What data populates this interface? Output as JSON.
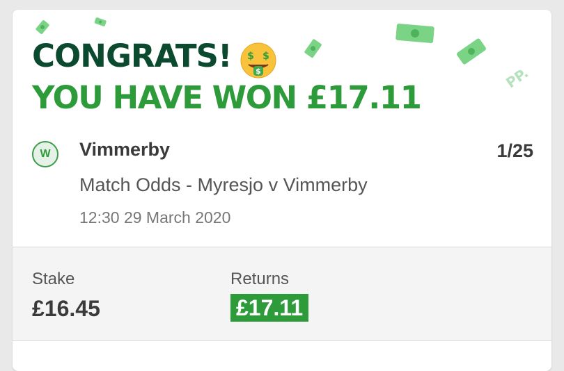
{
  "colors": {
    "dark_green": "#0b4a2e",
    "brand_green": "#2e9b3b",
    "money_green": "#7bd386",
    "light_green": "#b5e2bd"
  },
  "banner": {
    "line1": "CONGRATS!",
    "line2": "YOU HAVE WON £17.11",
    "emoji": "money-mouth-face-emoji",
    "watermark": "PP."
  },
  "bet": {
    "badge": "W",
    "selection": "Vimmerby",
    "odds": "1/25",
    "market": "Match Odds - Myresjo v Vimmerby",
    "datetime": "12:30 29 March 2020"
  },
  "summary": {
    "stake_label": "Stake",
    "stake_value": "£16.45",
    "returns_label": "Returns",
    "returns_value": "£17.11"
  }
}
